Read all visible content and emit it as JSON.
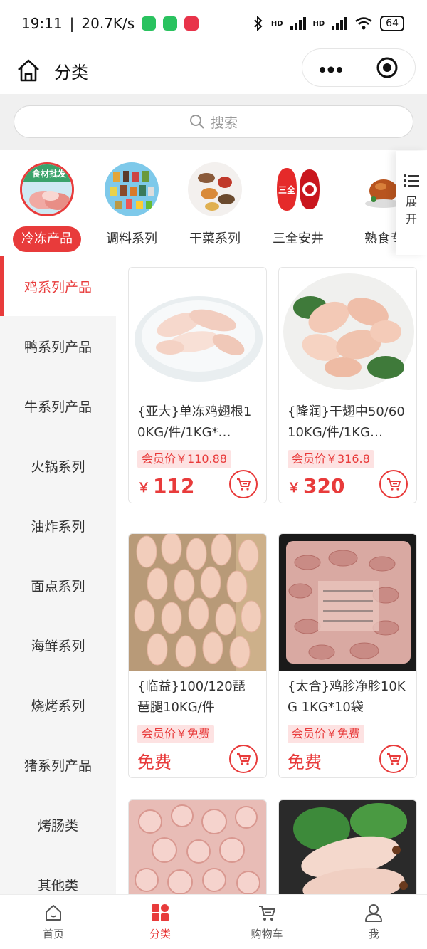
{
  "status_bar": {
    "time": "19:11",
    "speed": "20.7K/s",
    "battery": "64",
    "signal1": "HD",
    "signal2": "HD"
  },
  "nav": {
    "title": "分类"
  },
  "search": {
    "placeholder": "搜索"
  },
  "categories": [
    {
      "label": "冷冻产品",
      "active": true,
      "icon_text": "食材批发"
    },
    {
      "label": "调料系列",
      "active": false
    },
    {
      "label": "干菜系列",
      "active": false
    },
    {
      "label": "三全安井",
      "active": false,
      "icon_text": "三全"
    },
    {
      "label": "熟食专",
      "active": false
    }
  ],
  "expand": {
    "label": "展开"
  },
  "sidebar": {
    "items": [
      {
        "label": "鸡系列产品",
        "active": true
      },
      {
        "label": "鸭系列产品"
      },
      {
        "label": "牛系列产品"
      },
      {
        "label": "火锅系列"
      },
      {
        "label": "油炸系列"
      },
      {
        "label": "面点系列"
      },
      {
        "label": "海鲜系列"
      },
      {
        "label": "烧烤系列"
      },
      {
        "label": "猪系列产品"
      },
      {
        "label": "烤肠类"
      },
      {
        "label": "其他类"
      }
    ]
  },
  "products": [
    {
      "name": "{亚大}单冻鸡翅根10KG/件/1KG*…",
      "member_price": "会员价￥110.88",
      "price_symbol": "￥",
      "price": "112"
    },
    {
      "name": "{隆润}干翅中50/60 10KG/件/1KG…",
      "member_price": "会员价￥316.8",
      "price_symbol": "￥",
      "price": "320"
    },
    {
      "name": "{临益}100/120琵琶腿10KG/件",
      "member_price": "会员价￥免费",
      "price": "免费"
    },
    {
      "name": "{太合}鸡胗净胗10KG 1KG*10袋",
      "member_price": "会员价￥免费",
      "price": "免费"
    }
  ],
  "tabs": [
    {
      "label": "首页",
      "icon": "home-icon"
    },
    {
      "label": "分类",
      "icon": "category-icon",
      "active": true
    },
    {
      "label": "购物车",
      "icon": "cart-icon"
    },
    {
      "label": "我",
      "icon": "user-icon"
    }
  ],
  "colors": {
    "accent": "#e83b3b",
    "member_bg": "#fde2e2"
  }
}
